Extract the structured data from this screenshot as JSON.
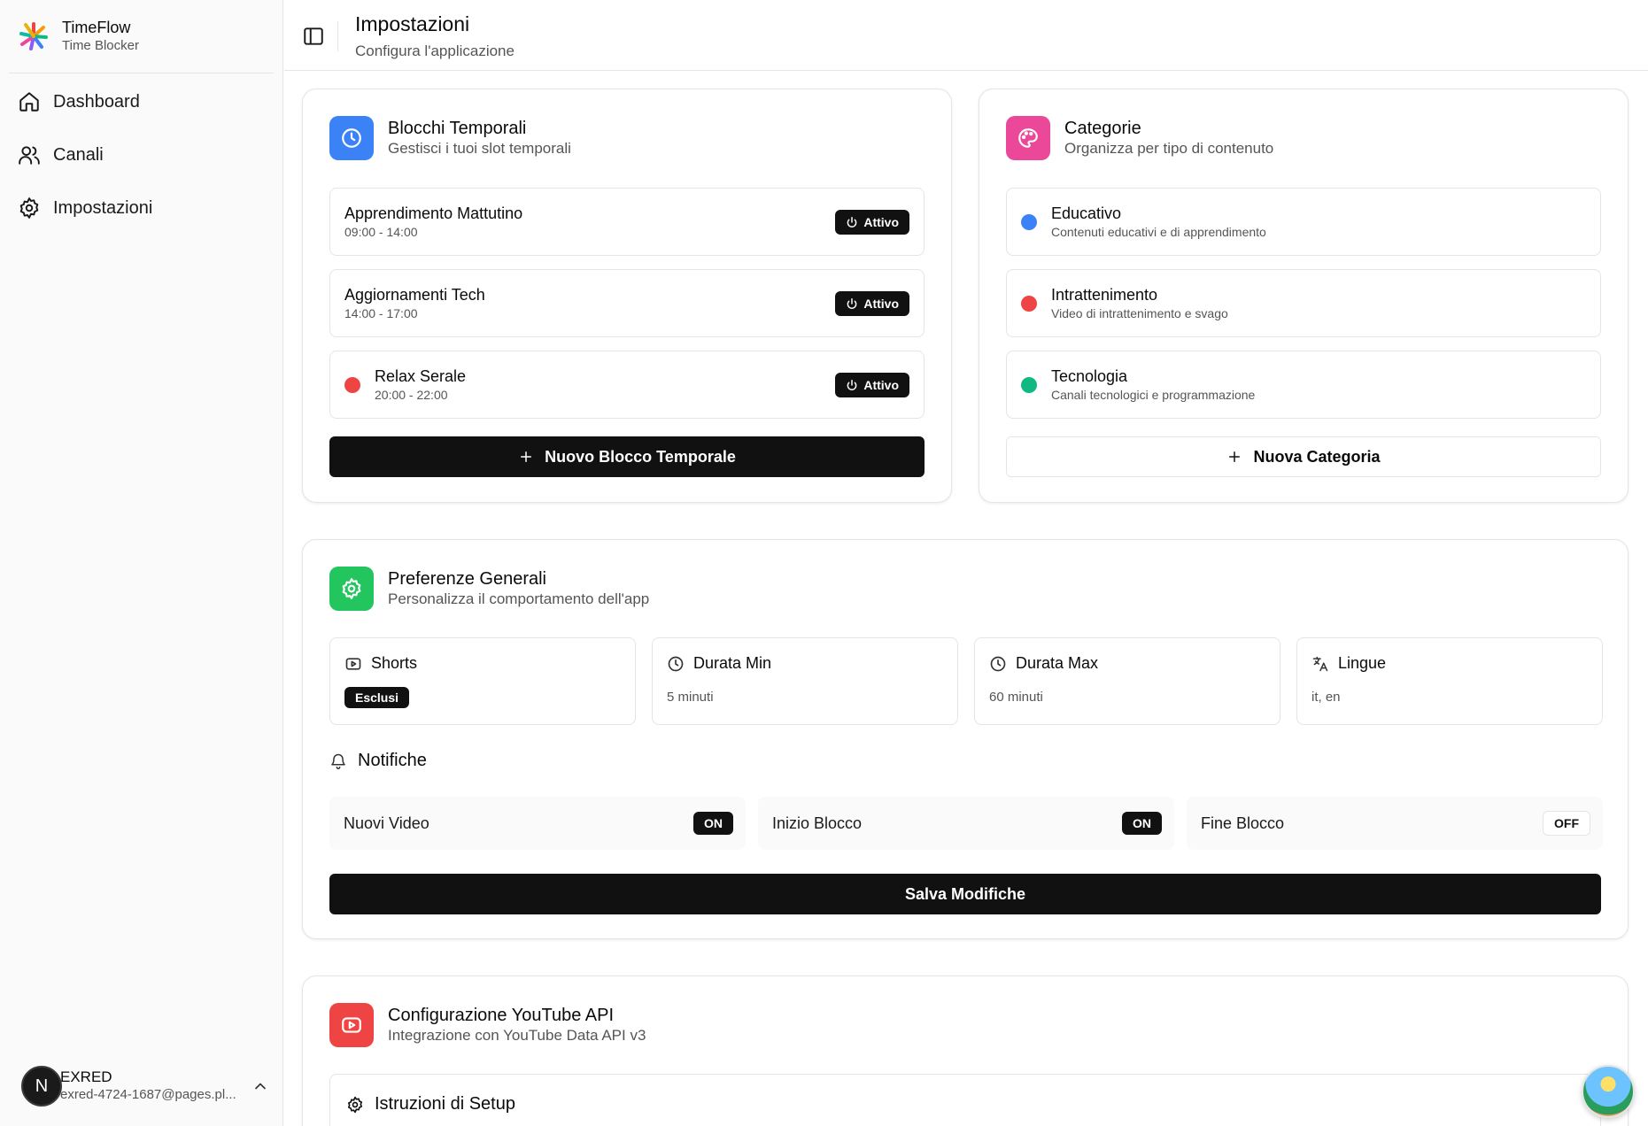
{
  "app": {
    "name": "TimeFlow",
    "subtitle": "Time Blocker"
  },
  "sidebar": {
    "items": [
      {
        "label": "Dashboard",
        "icon": "home-icon"
      },
      {
        "label": "Canali",
        "icon": "users-icon"
      },
      {
        "label": "Impostazioni",
        "icon": "gear-icon"
      }
    ]
  },
  "user": {
    "initial": "N",
    "name": "EXRED",
    "email": "exred-4724-1687@pages.pl..."
  },
  "header": {
    "title": "Impostazioni",
    "subtitle": "Configura l'applicazione"
  },
  "time_blocks": {
    "title": "Blocchi Temporali",
    "subtitle": "Gestisci i tuoi slot temporali",
    "items": [
      {
        "name": "Apprendimento Mattutino",
        "time": "09:00 - 14:00",
        "status": "Attivo",
        "dot": null
      },
      {
        "name": "Aggiornamenti Tech",
        "time": "14:00 - 17:00",
        "status": "Attivo",
        "dot": null
      },
      {
        "name": "Relax Serale",
        "time": "20:00 - 22:00",
        "status": "Attivo",
        "dot": "#ef4444"
      }
    ],
    "new_button": "Nuovo Blocco Temporale"
  },
  "categories": {
    "title": "Categorie",
    "subtitle": "Organizza per tipo di contenuto",
    "items": [
      {
        "name": "Educativo",
        "description": "Contenuti educativi e di apprendimento",
        "color": "#3b82f6"
      },
      {
        "name": "Intrattenimento",
        "description": "Video di intrattenimento e svago",
        "color": "#ef4444"
      },
      {
        "name": "Tecnologia",
        "description": "Canali tecnologici e programmazione",
        "color": "#10b981"
      }
    ],
    "new_button": "Nuova Categoria"
  },
  "preferences": {
    "title": "Preferenze Generali",
    "subtitle": "Personalizza il comportamento dell'app",
    "shorts": {
      "label": "Shorts",
      "value": "Esclusi"
    },
    "min_duration": {
      "label": "Durata Min",
      "value": "5 minuti"
    },
    "max_duration": {
      "label": "Durata Max",
      "value": "60 minuti"
    },
    "languages": {
      "label": "Lingue",
      "value": "it, en"
    },
    "notifications": {
      "title": "Notifiche",
      "items": [
        {
          "label": "Nuovi Video",
          "state": "ON"
        },
        {
          "label": "Inizio Blocco",
          "state": "ON"
        },
        {
          "label": "Fine Blocco",
          "state": "OFF"
        }
      ]
    },
    "save_button": "Salva Modifiche"
  },
  "youtube": {
    "title": "Configurazione YouTube API",
    "subtitle": "Integrazione con YouTube Data API v3",
    "setup_title": "Istruzioni di Setup"
  },
  "colors": {
    "blue_tile": "#3b82f6",
    "pink_tile": "#ec4899",
    "green_tile": "#22c55e",
    "red_tile": "#ef4444"
  }
}
